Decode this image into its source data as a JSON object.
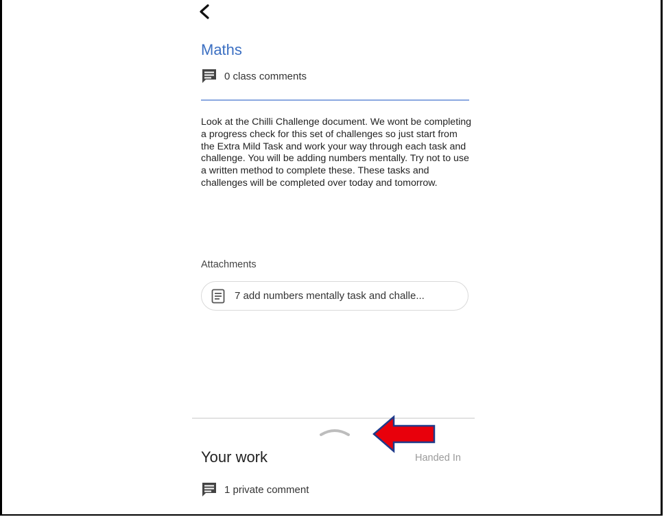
{
  "header": {
    "back_icon": "chevron-left-icon"
  },
  "assignment": {
    "title": "Maths",
    "class_comments": "0 class comments",
    "description": "Look at the Chilli Challenge document. We wont be completing a progress check for this set of challenges so just start from the Extra Mild Task and work your way through each task and challenge. You will be adding numbers mentally. Try not to use a written method to complete these. These tasks and challenges will be completed over today and tomorrow.",
    "attachments_label": "Attachments",
    "attachments": [
      {
        "name": "7 add numbers mentally task and challe...",
        "icon": "document-icon"
      }
    ]
  },
  "your_work": {
    "title": "Your work",
    "status": "Handed In",
    "private_comments": "1 private comment"
  },
  "colors": {
    "title": "#3b6fc2",
    "divider": "#8aa7e0",
    "annotation_arrow": "#e8000b"
  }
}
